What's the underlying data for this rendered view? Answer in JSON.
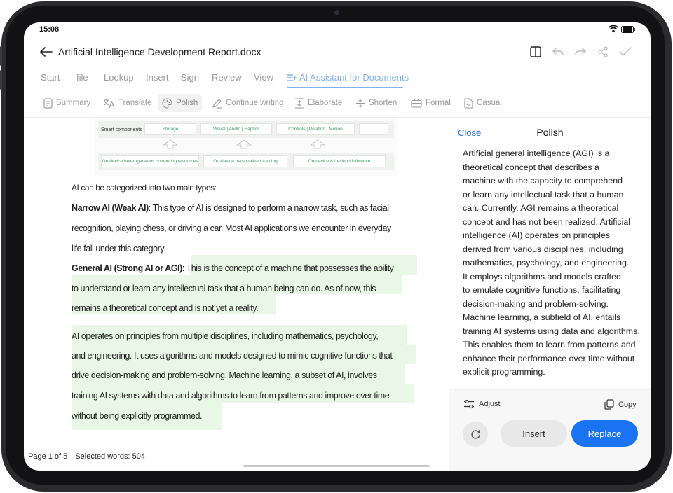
{
  "status": {
    "time": "15:08"
  },
  "document": {
    "title": "Artificial Intelligence Development Report.docx"
  },
  "menu": [
    "Start",
    "file",
    "Lookup",
    "Insert",
    "Sign",
    "Review",
    "View",
    "AI Assistant for Documents"
  ],
  "toolbar": [
    "Summary",
    "Translate",
    "Polish",
    "Continue writing",
    "Elaborate",
    "Shorten",
    "Formal",
    "Casual"
  ],
  "diagram": {
    "row_label": "Smart components",
    "top_boxes": [
      "Storage",
      "Visual | Audio | Haptics",
      "Controls | Position | Motion",
      "..."
    ],
    "bottom_boxes": [
      "On-device heterogeneous computing resources",
      "On-device personalized training",
      "On-device & in-cloud inference"
    ]
  },
  "body": {
    "intro": "AI can be categorized into two main types:",
    "narrow_title": "Narrow AI (Weak AI)",
    "narrow_lines": [
      ": This type of AI is designed to perform a narrow task, such as facial",
      "recognition, playing chess, or driving a car. Most AI applications we encounter in everyday",
      "life fall under this category."
    ],
    "general_title": "General AI (Strong AI or AGI)",
    "general_lines": [
      ": This is the concept of a machine that possesses the ability",
      "to understand or learn any intellectual task that a human being can do. As of now, this",
      "remains a theoretical concept and is not yet a reality."
    ],
    "para_lines": [
      "AI operates on principles from multiple disciplines, including mathematics, psychology,",
      "and engineering. It uses algorithms and models designed to mimic cognitive functions that",
      "drive decision-making and problem-solving. Machine learning, a subset of AI, involves",
      "training AI systems with data and algorithms to learn from patterns and improve over time",
      "without being explicitly programmed."
    ]
  },
  "footer": {
    "page": "Page 1 of 5",
    "selected": "Selected words: 504"
  },
  "panel": {
    "close": "Close",
    "title": "Polish",
    "lines": [
      "Artificial general intelligence (AGI) is a",
      "theoretical concept that describes a",
      "machine with the capacity to comprehend",
      "or learn any intellectual task that a human",
      "can. Currently, AGI remains a theoretical",
      "concept and has not been realized. Artificial",
      "intelligence (AI) operates on principles",
      "derived from various disciplines, including",
      "mathematics, psychology, and engineering.",
      "It employs algorithms and models crafted",
      "to emulate cognitive functions, facilitating",
      "decision-making and problem-solving.",
      "Machine learning, a subfield of AI, entails",
      "training AI systems using data and algorithms.",
      "This enables them to learn from patterns and",
      "enhance their performance over time without",
      "explicit programming."
    ],
    "adjust": "Adjust",
    "copy": "Copy",
    "insert": "Insert",
    "replace": "Replace"
  },
  "colors": {
    "accent": "#1a73f0",
    "highlight": "#e9f7e6",
    "tab_active": "#7fb0f2"
  }
}
